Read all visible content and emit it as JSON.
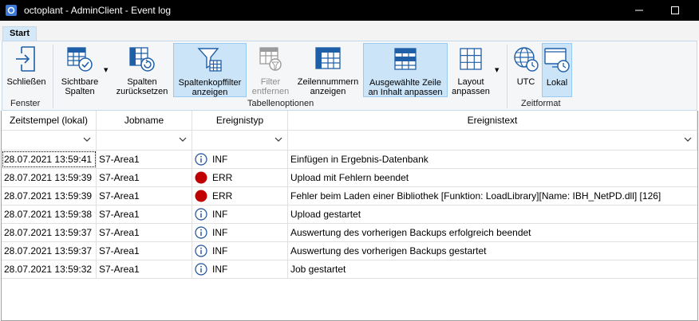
{
  "window": {
    "title": "octoplant - AdminClient - Event log",
    "app_icon": "octoplant-app-icon",
    "controls": [
      "minimize-icon",
      "maximize-icon"
    ]
  },
  "ribbon": {
    "tab": "Start",
    "buttons": {
      "close": {
        "line1": "Schließen",
        "line2": "",
        "icon": "exit-door-icon"
      },
      "visible_columns": {
        "line1": "Sichtbare",
        "line2": "Spalten",
        "icon": "table-check-icon"
      },
      "reset_columns": {
        "line1": "Spalten",
        "line2": "zurücksetzen",
        "icon": "table-reset-icon"
      },
      "show_header_filter": {
        "line1": "Spaltenkopffilter",
        "line2": "anzeigen",
        "icon": "funnel-table-icon",
        "selected": true
      },
      "remove_filter": {
        "line1": "Filter",
        "line2": "entfernen",
        "icon": "filter-remove-icon",
        "disabled": true
      },
      "show_row_numbers": {
        "line1": "Zeilennummern",
        "line2": "anzeigen",
        "icon": "row-numbers-icon"
      },
      "fit_row": {
        "line1": "Ausgewählte Zeile",
        "line2": "an Inhalt anpassen",
        "icon": "fit-row-icon",
        "selected": true
      },
      "layout": {
        "line1": "Layout",
        "line2": "anpassen",
        "icon": "grid-layout-icon"
      },
      "utc": {
        "line1": "UTC",
        "icon": "globe-clock-icon"
      },
      "local": {
        "line1": "Lokal",
        "icon": "monitor-clock-icon",
        "selected": true
      }
    },
    "groups": {
      "window": "Fenster",
      "table": "Tabellenoptionen",
      "time": "Zeitformat"
    }
  },
  "grid": {
    "columns": [
      "Zeitstempel (lokal)",
      "Jobname",
      "Ereignistyp",
      "Ereignistext"
    ],
    "rows": [
      {
        "time": "28.07.2021 13:59:41",
        "job": "S7-Area1",
        "type": "INF",
        "icon": "info-icon",
        "text": "Einfügen in Ergebnis-Datenbank"
      },
      {
        "time": "28.07.2021 13:59:39",
        "job": "S7-Area1",
        "type": "ERR",
        "icon": "error-dot-icon",
        "text": "Upload mit Fehlern beendet"
      },
      {
        "time": "28.07.2021 13:59:39",
        "job": "S7-Area1",
        "type": "ERR",
        "icon": "error-dot-icon",
        "text": "Fehler beim Laden einer Bibliothek [Funktion: LoadLibrary][Name: IBH_NetPD.dll] [126]"
      },
      {
        "time": "28.07.2021 13:59:38",
        "job": "S7-Area1",
        "type": "INF",
        "icon": "info-icon",
        "text": "Upload gestartet"
      },
      {
        "time": "28.07.2021 13:59:37",
        "job": "S7-Area1",
        "type": "INF",
        "icon": "info-icon",
        "text": "Auswertung des vorherigen Backups erfolgreich beendet"
      },
      {
        "time": "28.07.2021 13:59:37",
        "job": "S7-Area1",
        "type": "INF",
        "icon": "info-icon",
        "text": "Auswertung des vorherigen Backups gestartet"
      },
      {
        "time": "28.07.2021 13:59:32",
        "job": "S7-Area1",
        "type": "INF",
        "icon": "info-icon",
        "text": "Job gestartet"
      }
    ]
  },
  "colors": {
    "selected_button_bg": "#cce4f7",
    "error_red": "#c00000",
    "info_blue": "#1e4f9c",
    "icon_blue": "#1f5fa8"
  }
}
